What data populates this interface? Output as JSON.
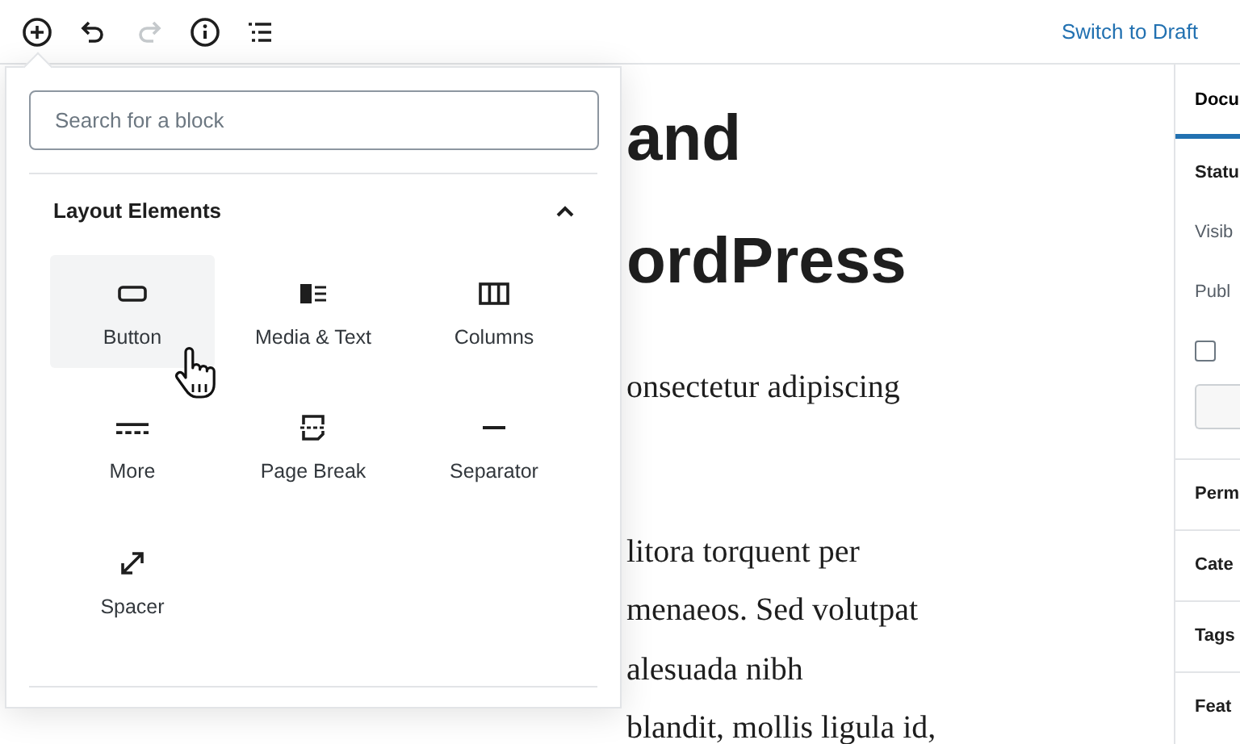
{
  "toolbar": {
    "tools": [
      {
        "kind": "add",
        "disabled": false
      },
      {
        "kind": "undo",
        "disabled": false
      },
      {
        "kind": "redo",
        "disabled": true
      },
      {
        "kind": "info",
        "disabled": false
      },
      {
        "kind": "outline",
        "disabled": false
      }
    ],
    "switch_link": "Switch to Draft"
  },
  "editor": {
    "title_lines": [
      "and",
      "ordPress"
    ],
    "paragraphs": [
      [
        "onsectetur adipiscing"
      ],
      [
        "litora torquent per",
        "menaeos. Sed volutpat",
        "alesuada nibh",
        "blandit, mollis ligula id,"
      ]
    ]
  },
  "sidebar": {
    "tabs": [
      {
        "label": "Docu",
        "selected": true
      }
    ],
    "status": {
      "title": "Statu",
      "rows": [
        "Visib",
        "Publ"
      ],
      "checkbox": {
        "checked": false
      }
    },
    "sections": [
      "Perm",
      "Cate",
      "Tags",
      "Feat"
    ]
  },
  "inserter": {
    "search": {
      "placeholder": "Search for a block"
    },
    "category": {
      "title": "Layout Elements",
      "expanded": true
    },
    "blocks": [
      {
        "label": "Button",
        "kind": "button",
        "selected": true
      },
      {
        "label": "Media & Text",
        "kind": "media-text",
        "selected": false
      },
      {
        "label": "Columns",
        "kind": "columns",
        "selected": false
      },
      {
        "label": "More",
        "kind": "more",
        "selected": false
      },
      {
        "label": "Page Break",
        "kind": "page-break",
        "selected": false
      },
      {
        "label": "Separator",
        "kind": "separator",
        "selected": false
      },
      {
        "label": "Spacer",
        "kind": "spacer",
        "selected": false
      }
    ]
  }
}
